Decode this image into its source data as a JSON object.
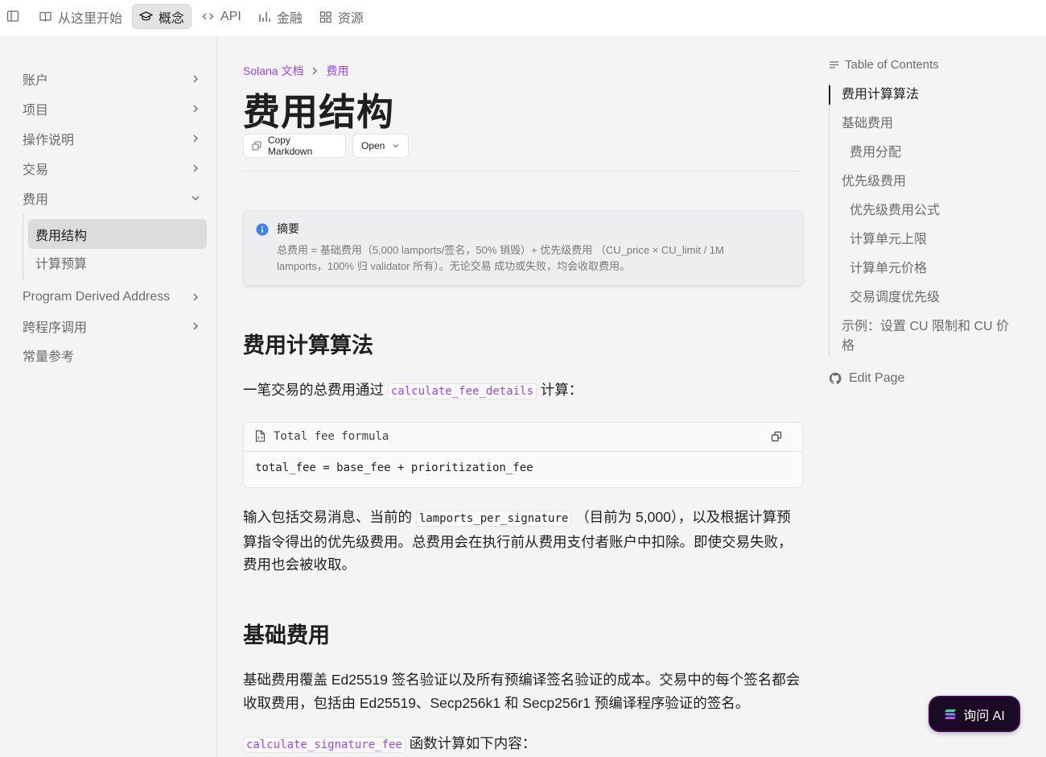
{
  "topnav": {
    "items": [
      {
        "label": "从这里开始",
        "icon": "book-icon"
      },
      {
        "label": "概念",
        "icon": "graduation-cap-icon",
        "active": true
      },
      {
        "label": "API",
        "icon": "code-icon"
      },
      {
        "label": "金融",
        "icon": "bar-chart-icon"
      },
      {
        "label": "资源",
        "icon": "grid-icon"
      }
    ]
  },
  "sidebar": {
    "items": [
      {
        "label": "账户"
      },
      {
        "label": "项目"
      },
      {
        "label": "操作说明"
      },
      {
        "label": "交易"
      },
      {
        "label": "费用",
        "expanded": true
      },
      {
        "label": "Program Derived Address"
      },
      {
        "label": "跨程序调用"
      },
      {
        "label": "常量参考"
      }
    ],
    "subitems": [
      {
        "label": "费用结构",
        "active": true
      },
      {
        "label": "计算预算"
      }
    ]
  },
  "breadcrumb": {
    "root": "Solana 文档",
    "current": "费用"
  },
  "page": {
    "title": "费用结构",
    "copy_markdown_label": "Copy Markdown",
    "open_label": "Open"
  },
  "callout": {
    "title": "摘要",
    "text": "总费用 = 基础费用（5,000 lamports/签名，50% 销毁）+ 优先级费用 （CU_price × CU_limit / 1M lamports，100% 归 validator 所有）。无论交易 成功或失败，均会收取费用。"
  },
  "section1": {
    "heading": "费用计算算法",
    "p1_before": "一笔交易的总费用通过",
    "p1_code": "calculate_fee_details",
    "p1_after": "计算：",
    "code_caption": "Total fee formula",
    "code_line": "total_fee = base_fee + prioritization_fee",
    "p2_before": "输入包括交易消息、当前的",
    "p2_code": "lamports_per_signature",
    "p2_after": "（目前为 5,000），以及根据计算预算指令得出的优先级费用。总费用会在执行前从费用支付者账户中扣除。即使交易失败，费用也会被收取。"
  },
  "section2": {
    "heading": "基础费用",
    "p1": "基础费用覆盖 Ed25519 签名验证以及所有预编译签名验证的成本。交易中的每个签名都会收取费用，包括由 Ed25519、Secp256k1 和 Secp256r1 预编译程序验证的签名。",
    "p2_code": "calculate_signature_fee",
    "p2_after": "函数计算如下内容："
  },
  "toc": {
    "heading": "Table of Contents",
    "items": [
      {
        "label": "费用计算算法",
        "active": true
      },
      {
        "label": "基础费用"
      },
      {
        "label": "费用分配"
      },
      {
        "label": "优先级费用"
      },
      {
        "label": "优先级费用公式"
      },
      {
        "label": "计算单元上限"
      },
      {
        "label": "计算单元价格"
      },
      {
        "label": "交易调度优先级"
      },
      {
        "label": "示例：设置 CU 限制和 CU 价格"
      }
    ],
    "edit_page": "Edit Page"
  },
  "ask_ai": {
    "label": "询问 AI"
  },
  "colors": {
    "accent": "#9945ff",
    "ask_ai_bg": "#1a0a24"
  }
}
